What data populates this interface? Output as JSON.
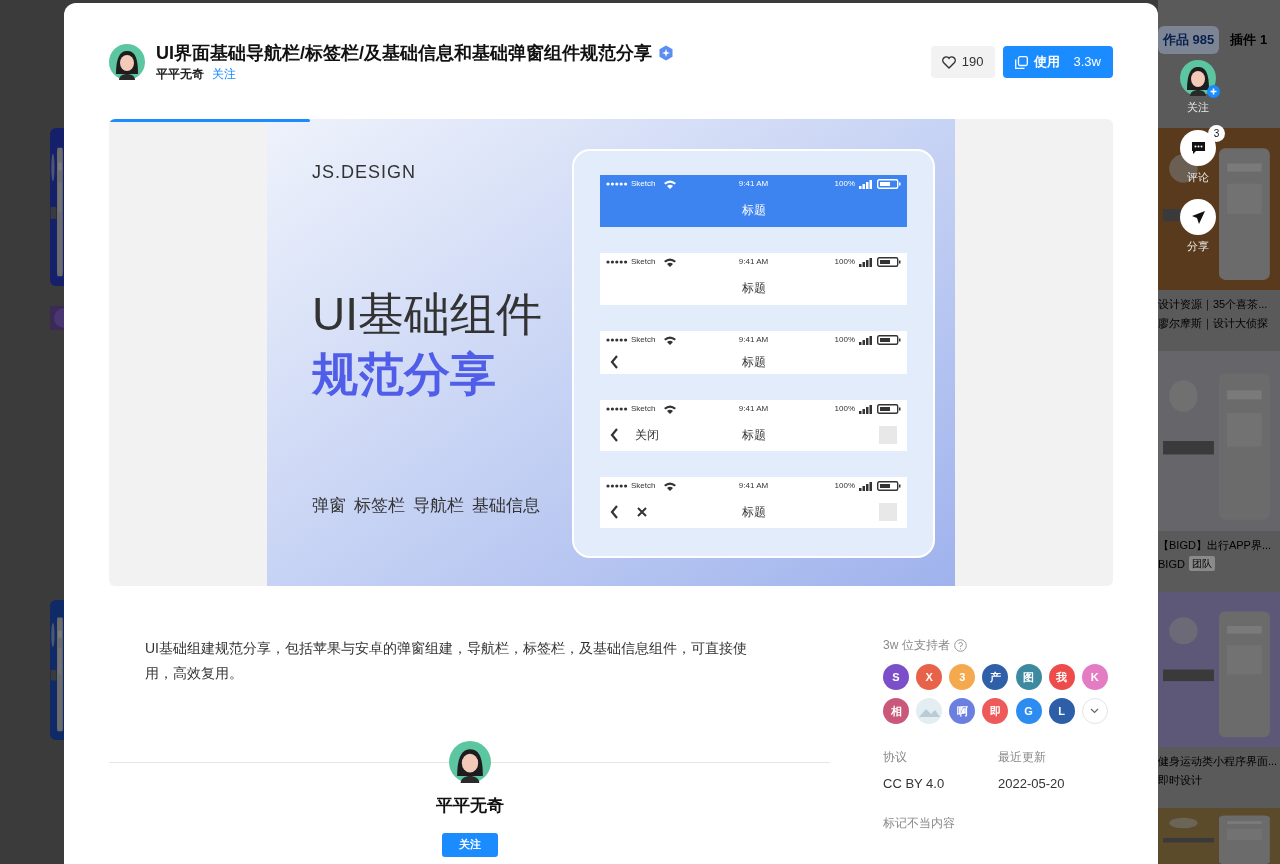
{
  "background": {
    "tabs": [
      {
        "label": "作品 985",
        "selected": true
      },
      {
        "label": "插件 1",
        "selected": false
      }
    ],
    "cards": [
      {
        "title": "设计资源｜35个喜茶...",
        "author": "廖尔摩斯｜设计大侦探"
      },
      {
        "title": "【BIGD】出行APP界...",
        "author": "BIGD",
        "tag": "团队"
      },
      {
        "title": "健身运动类小程序界面...",
        "author": "即时设计"
      }
    ]
  },
  "side_actions": [
    {
      "kind": "follow",
      "label": "关注"
    },
    {
      "kind": "comment",
      "label": "评论",
      "badge": "3"
    },
    {
      "kind": "share",
      "label": "分享"
    }
  ],
  "header": {
    "title": "UI界面基础导航栏/标签栏/及基础信息和基础弹窗组件规范分享",
    "verified": true,
    "author": "平平无奇",
    "follow": "关注",
    "likes": "190",
    "use_label": "使用",
    "use_count": "3.3w"
  },
  "carousel": {
    "level": 0.2,
    "brand": "JS.DESIGN",
    "headline": "UI基础组件",
    "subline": "规范分享",
    "tags": [
      "弹窗",
      "标签栏",
      "导航栏",
      "基础信息"
    ],
    "bars": [
      {
        "kind": "primary",
        "carrier": "Sketch",
        "time": "9:41 AM",
        "battery": "100%",
        "title": "标题"
      },
      {
        "kind": "plain",
        "carrier": "Sketch",
        "time": "9:41 AM",
        "battery": "100%",
        "title": "标题"
      },
      {
        "kind": "back",
        "carrier": "Sketch",
        "time": "9:41 AM",
        "battery": "100%",
        "title": "标题"
      },
      {
        "kind": "back_text",
        "carrier": "Sketch",
        "time": "9:41 AM",
        "battery": "100%",
        "title": "标题",
        "left_text": "关闭"
      },
      {
        "kind": "back_close",
        "carrier": "Sketch",
        "time": "9:41 AM",
        "battery": "100%",
        "title": "标题"
      }
    ]
  },
  "description": "UI基础组建规范分享，包括苹果与安卓的弹窗组建，导航栏，标签栏，及基础信息组件，可直接使用，高效复用。",
  "author_card": {
    "name": "平平无奇",
    "follow": "关注"
  },
  "supporters": {
    "label": "3w 位支持者",
    "items": [
      {
        "kind": "letter",
        "text": "S",
        "color": "#7b4fc9"
      },
      {
        "kind": "letter",
        "text": "X",
        "color": "#e8624a"
      },
      {
        "kind": "letter",
        "text": "3",
        "color": "#f5a94f"
      },
      {
        "kind": "letter",
        "text": "产",
        "color": "#2f5fa8"
      },
      {
        "kind": "letter",
        "text": "图",
        "color": "#3d8aa0"
      },
      {
        "kind": "letter",
        "text": "我",
        "color": "#ee4b4b"
      },
      {
        "kind": "letter",
        "text": "K",
        "color": "#e47cc4"
      },
      {
        "kind": "letter",
        "text": "相",
        "color": "#c9587a"
      },
      {
        "kind": "picture"
      },
      {
        "kind": "letter",
        "text": "啊",
        "color": "#6b7fe0"
      },
      {
        "kind": "letter",
        "text": "即",
        "color": "#ee5a5a"
      },
      {
        "kind": "letter",
        "text": "G",
        "color": "#2d8cf0"
      },
      {
        "kind": "letter",
        "text": "L",
        "color": "#2d5fa8"
      }
    ]
  },
  "meta": [
    {
      "label": "协议",
      "value": "CC BY 4.0"
    },
    {
      "label": "最近更新",
      "value": "2022-05-20"
    }
  ],
  "report": "标记不当内容"
}
